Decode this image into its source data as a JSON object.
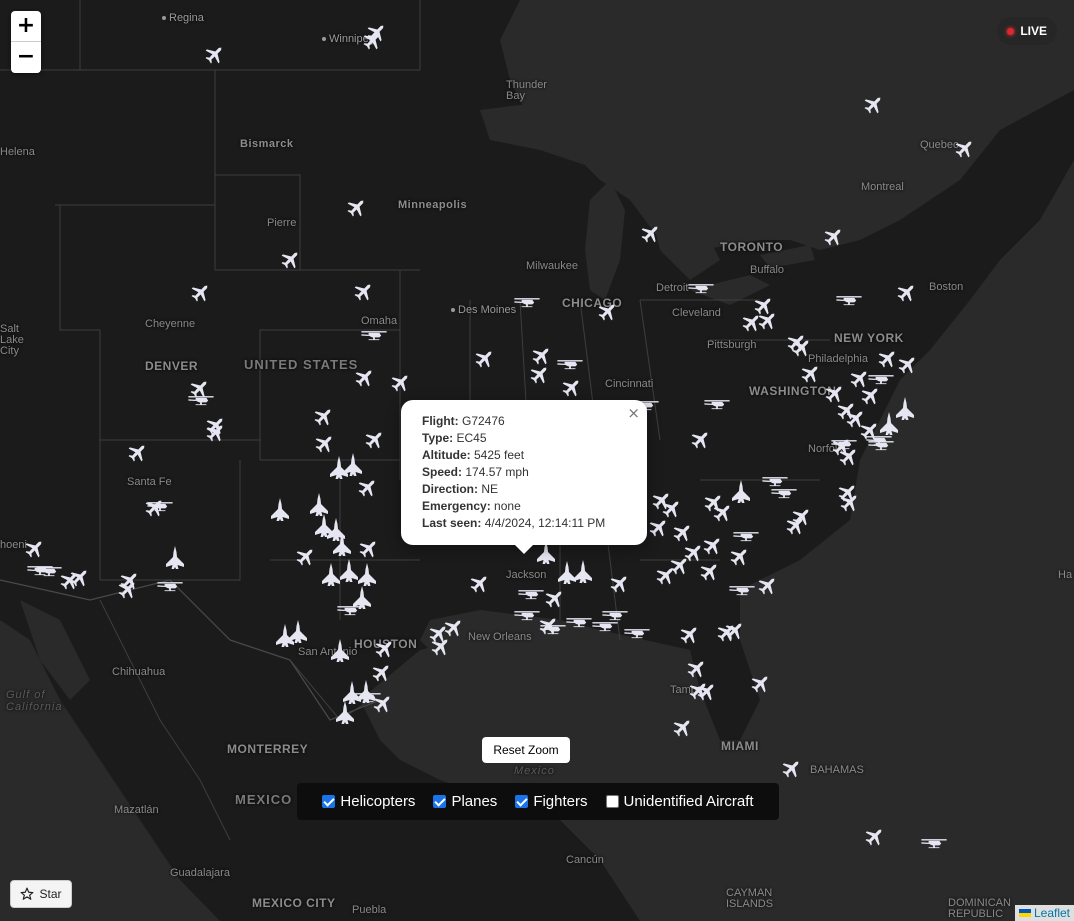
{
  "live_badge": {
    "label": "LIVE"
  },
  "zoom": {
    "in_label": "+",
    "out_label": "−"
  },
  "popup": {
    "rows": [
      {
        "key": "Flight:",
        "value": "G72476"
      },
      {
        "key": "Type:",
        "value": "EC45"
      },
      {
        "key": "Altitude:",
        "value": "5425 feet"
      },
      {
        "key": "Speed:",
        "value": "174.57 mph"
      },
      {
        "key": "Direction:",
        "value": "NE"
      },
      {
        "key": "Emergency:",
        "value": "none"
      },
      {
        "key": "Last seen:",
        "value": "4/4/2024, 12:14:11 PM"
      }
    ],
    "close_label": "×"
  },
  "reset_zoom": {
    "label": "Reset Zoom"
  },
  "filters": [
    {
      "label": "Helicopters",
      "checked": true
    },
    {
      "label": "Planes",
      "checked": true
    },
    {
      "label": "Fighters",
      "checked": true
    },
    {
      "label": "Unidentified Aircraft",
      "checked": false
    }
  ],
  "star_button": {
    "label": "Star"
  },
  "attribution": {
    "label": "Leaflet"
  },
  "map_labels": {
    "regina": "Regina",
    "winnipeg": "Winnipeg",
    "thunder_bay": "Thunder Bay",
    "helena": "Helena",
    "bismarck": "Bismarck",
    "pierre": "Pierre",
    "minneapolis": "Minneapolis",
    "quebec": "Quebec",
    "montreal": "Montreal",
    "toronto": "TORONTO",
    "buffalo": "Buffalo",
    "boston": "Boston",
    "milwaukee": "Milwaukee",
    "chicago": "CHICAGO",
    "detroit": "Detroit",
    "cleveland": "Cleveland",
    "salt_lake_city": "Salt Lake City",
    "cheyenne": "Cheyenne",
    "omaha": "Omaha",
    "des_moines": "Des Moines",
    "new_york": "NEW YORK",
    "pittsburgh": "Pittsburgh",
    "philadelphia": "Philadelphia",
    "denver": "DENVER",
    "united_states": "UNITED STATES",
    "cincinnati": "Cincinnati",
    "washington": "WASHINGTON",
    "santa_fe": "Santa Fe",
    "phoenix": "Phoenix",
    "jackson": "Jackson",
    "norfolk": "Norfolk",
    "chihuahua": "Chihuahua",
    "new_orleans": "New Orleans",
    "houston": "HOUSTON",
    "san_antonio": "San Antonio",
    "gulf_california": "Gulf of California",
    "monterrey": "MONTERREY",
    "miami": "MIAMI",
    "mexico_water": "Mexico",
    "mexico": "MEXICO",
    "bahamas": "BAHAMAS",
    "mazatlan": "Mazatlán",
    "guadalajara": "Guadalajara",
    "cancun": "Cancún",
    "mexico_city": "MEXICO CITY",
    "puebla": "Puebla",
    "cayman": "CAYMAN ISLANDS",
    "dominican": "DOMINICAN REPUBLIC",
    "tampa": "Tampa",
    "ha": "Ha",
    "phx": "hoeni"
  }
}
